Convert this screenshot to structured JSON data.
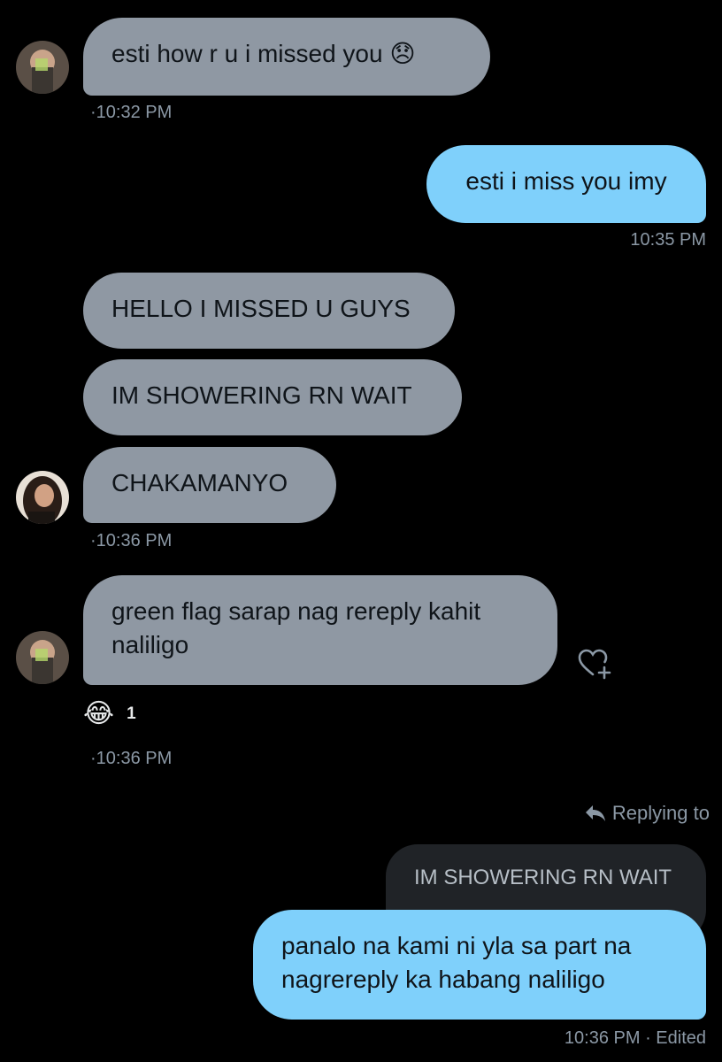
{
  "messages": [
    {
      "text": "esti how r u i missed you",
      "emoji": "😞",
      "time": "10:32 PM"
    },
    {
      "text": "esti i miss you imy",
      "time": "10:35 PM"
    },
    {
      "text": "HELLO I MISSED U GUYS"
    },
    {
      "text": "IM SHOWERING RN WAIT"
    },
    {
      "text": "CHAKAMANYO",
      "time": "10:36 PM"
    },
    {
      "text": "green flag sarap nag rereply kahit naliligo",
      "time": "10:36 PM",
      "reaction": {
        "emoji": "😂",
        "count": "1"
      }
    },
    {
      "replying_label": "Replying to",
      "quoted": "IM SHOWERING RN WAIT",
      "text": "panalo na kami ni yla sa part na nagrereply ka habang naliligo",
      "time": "10:36 PM · Edited"
    }
  ],
  "colors": {
    "background": "#000000",
    "incoming_bubble": "#8f98a3",
    "outgoing_bubble": "#7fd0fb",
    "quoted_bubble": "#202327",
    "timestamp": "#8b98a5"
  },
  "icons": [
    "avatar",
    "heart-plus-icon",
    "reply-arrow-icon"
  ]
}
